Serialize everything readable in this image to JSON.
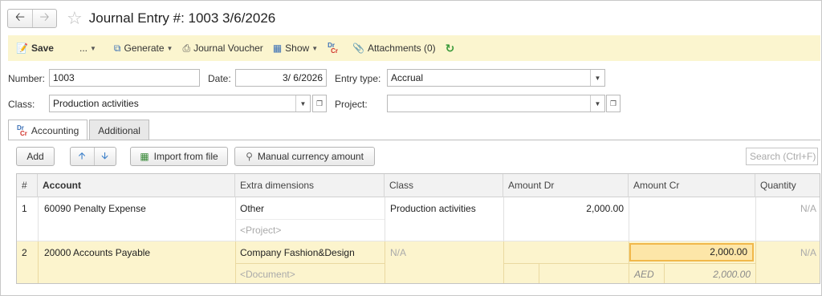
{
  "window": {
    "title": "Journal Entry #: 1003 3/6/2026"
  },
  "nav": {
    "back_icon": "arrow-left-icon",
    "forward_icon": "arrow-right-icon",
    "favorite_icon": "star-icon"
  },
  "toolbar": {
    "save_label": "Save",
    "more_label": "...",
    "generate_label": "Generate",
    "journal_voucher_label": "Journal Voucher",
    "show_label": "Show",
    "drcr_dr": "Dr",
    "drcr_cr": "Cr",
    "attachments_label": "Attachments (0)"
  },
  "form": {
    "number_label": "Number:",
    "number_value": "1003",
    "date_label": "Date:",
    "date_value": "3/ 6/2026",
    "entry_type_label": "Entry type:",
    "entry_type_value": "Accrual",
    "class_label": "Class:",
    "class_value": "Production activities",
    "project_label": "Project:",
    "project_value": ""
  },
  "tabs": [
    {
      "label": "Accounting",
      "active": true
    },
    {
      "label": "Additional",
      "active": false
    }
  ],
  "table_toolbar": {
    "add_label": "Add",
    "import_label": "Import from file",
    "manual_currency_label": "Manual currency amount",
    "search_placeholder": "Search (Ctrl+F)"
  },
  "grid": {
    "columns": [
      "#",
      "Account",
      "Extra dimensions",
      "Class",
      "Amount Dr",
      "Amount Cr",
      "Quantity"
    ],
    "rows": [
      {
        "num": "1",
        "account": "60090 Penalty Expense",
        "extra_dim_1": "Other",
        "extra_dim_2": "<Project>",
        "class": "Production activities",
        "amount_dr": "2,000.00",
        "amount_cr": "",
        "quantity": "N/A"
      },
      {
        "num": "2",
        "account": "20000 Accounts Payable",
        "extra_dim_1": "Company Fashion&Design",
        "extra_dim_2": "<Document>",
        "class": "N/A",
        "amount_dr": "",
        "amount_cr": "2,000.00",
        "currency": "AED",
        "currency_amount": "2,000.00",
        "quantity": "N/A"
      }
    ]
  },
  "colors": {
    "toolbar_bg": "#fbf5cf",
    "selected_row_bg": "#fcf4cd",
    "active_cell_border": "#f1b84b"
  }
}
